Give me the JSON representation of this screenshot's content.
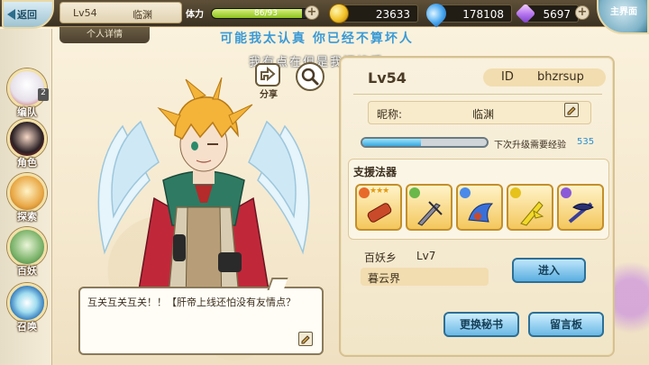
{
  "topbar": {
    "back_label": "返回",
    "level": "Lv54",
    "player_name": "临渊",
    "stamina_label": "体力",
    "stamina_value": "86/93",
    "stamina_fraction": 0.925,
    "coins": "23633",
    "water": "178108",
    "gems": "5697",
    "home_label": "主界面",
    "details_tab": "个人详情"
  },
  "sidebar": {
    "items": [
      {
        "label": "编队",
        "badge": "2"
      },
      {
        "label": "角色"
      },
      {
        "label": "探索"
      },
      {
        "label": "百妖"
      },
      {
        "label": "召唤"
      }
    ]
  },
  "subtitles": {
    "line1": "可能我太认真 你已经不算坏人",
    "line2": "我有点在但是我还接受"
  },
  "share_label": "分享",
  "chat": {
    "text": "互关互关互关！！【肝帝上线还怕没有友情点？"
  },
  "profile": {
    "level": "Lv54",
    "id_label": "ID",
    "id_value": "bhzrsup",
    "nickname_label": "昵称:",
    "nickname_value": "临渊",
    "exp_label": "下次升级需要经验",
    "exp_value": "535",
    "exp_fraction": 0.47,
    "support_label": "支援法器",
    "treasures": [
      {
        "name": "red-scroll-treasure",
        "stars": "★★★",
        "color": "#c94a2a"
      },
      {
        "name": "sword-treasure",
        "stars": "",
        "color": "#5a5a6a"
      },
      {
        "name": "blue-wing-treasure",
        "stars": "",
        "color": "#3a6fd8"
      },
      {
        "name": "yellow-blade-treasure",
        "stars": "",
        "color": "#e6c21a"
      },
      {
        "name": "purple-spear-treasure",
        "stars": "",
        "color": "#3a3f9a"
      }
    ],
    "guild_label": "百妖乡",
    "guild_level": "Lv7",
    "guild_name": "暮云界",
    "join_label": "进入",
    "swap_secret_label": "更换秘书",
    "message_board_label": "留言板"
  }
}
